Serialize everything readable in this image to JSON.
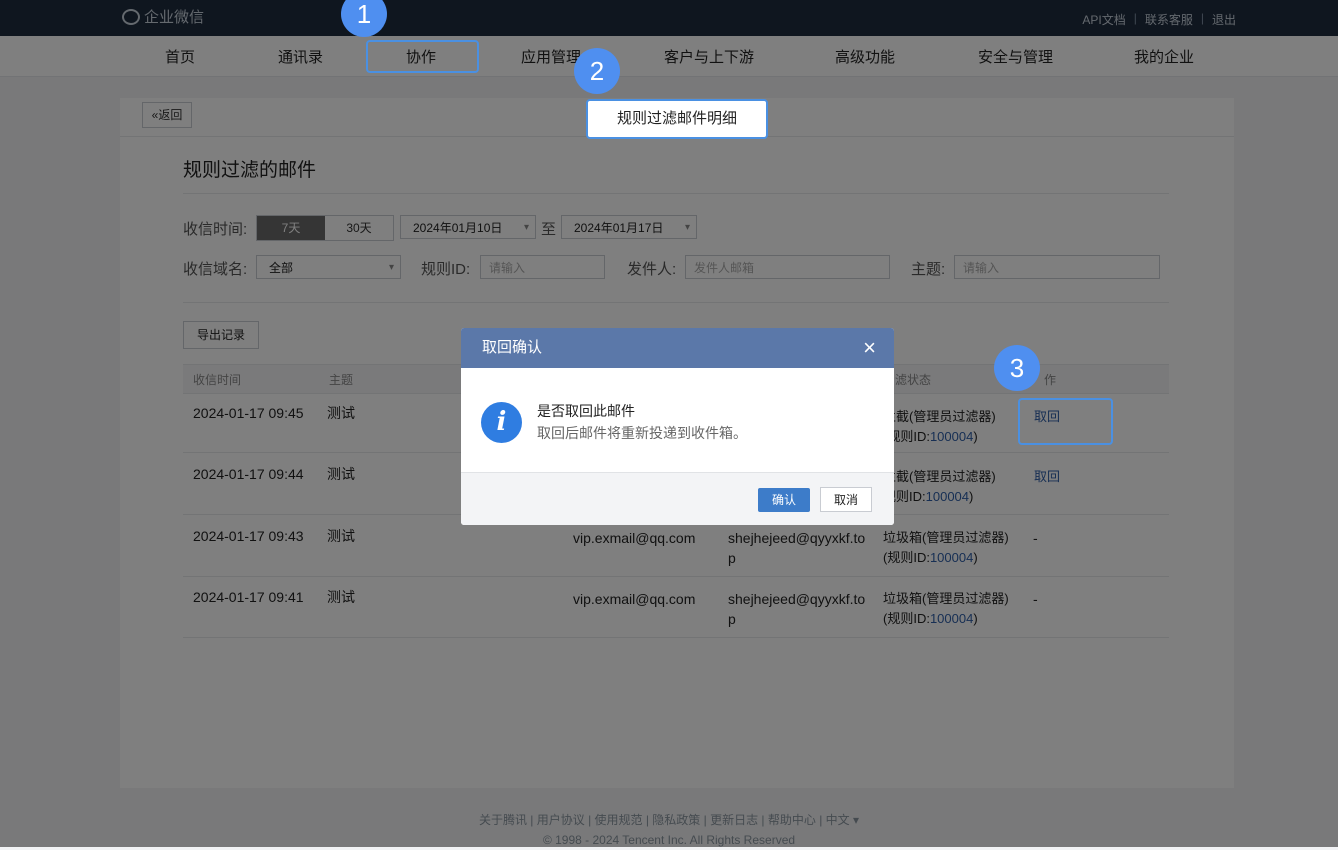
{
  "topbar": {
    "logo": "企业微信",
    "links": [
      "API文档",
      "联系客服",
      "退出"
    ]
  },
  "nav": {
    "items": [
      "首页",
      "通讯录",
      "协作",
      "应用管理",
      "客户与上下游",
      "高级功能",
      "安全与管理",
      "我的企业"
    ]
  },
  "page": {
    "back_label": "«返回",
    "header_title": "规则过滤邮件明细",
    "section_title": "规则过滤的邮件",
    "filters": {
      "time_label": "收信时间:",
      "time_options": [
        "7天",
        "30天"
      ],
      "date_from": "2024年01月10日",
      "date_sep": "至",
      "date_to": "2024年01月17日",
      "domain_label": "收信域名:",
      "domain_value": "全部",
      "rule_label": "规则ID:",
      "rule_placeholder": "请输入",
      "sender_label": "发件人:",
      "sender_placeholder": "发件人邮箱",
      "subject_label": "主题:",
      "subject_placeholder": "请输入"
    },
    "export_label": "导出记录",
    "table": {
      "headers": [
        "收信时间",
        "主题",
        "滤状态",
        "作"
      ],
      "rows": [
        {
          "time": "2024-01-17 09:45",
          "subject": "测试",
          "from": "",
          "to": "",
          "status1": "拦截(管理员过滤器)",
          "status2": "(规则ID:",
          "rule_id": "100004",
          "status_end": ")",
          "action": "取回"
        },
        {
          "time": "2024-01-17 09:44",
          "subject": "测试",
          "from": "",
          "to": "",
          "status1": "拦截(管理员过滤器)",
          "status2": "规则ID:",
          "rule_id": "100004",
          "status_end": ")",
          "action": "取回"
        },
        {
          "time": "2024-01-17 09:43",
          "subject": "测试",
          "from": "vip.exmail@qq.com",
          "to1": "shejhejeed@qyyxkf.to",
          "to2": "p",
          "status1": "垃圾箱(管理员过滤器)",
          "status2": "(规则ID:",
          "rule_id": "100004",
          "status_end": ")",
          "action": "-"
        },
        {
          "time": "2024-01-17 09:41",
          "subject": "测试",
          "from": "vip.exmail@qq.com",
          "to1": "shejhejeed@qyyxkf.to",
          "to2": "p",
          "status1": "垃圾箱(管理员过滤器)",
          "status2": "(规则ID:",
          "rule_id": "100004",
          "status_end": ")",
          "action": "-"
        }
      ]
    }
  },
  "dialog": {
    "title": "取回确认",
    "close": "×",
    "icon": "i",
    "message": "是否取回此邮件",
    "detail": "取回后邮件将重新投递到收件箱。",
    "ok_label": "确认",
    "cancel_label": "取消"
  },
  "footer": {
    "links": "关于腾讯 | 用户协议 | 使用规范 | 隐私政策 | 更新日志 | 帮助中心 | 中文 ▾",
    "copyright": "© 1998 - 2024 Tencent Inc. All Rights Reserved"
  },
  "markers": [
    "1",
    "2",
    "3"
  ],
  "colors": {
    "topbar": "#1f2c3f",
    "accent": "#4a90e2",
    "dialog_header": "#5b78a9",
    "link": "#2f5fa8"
  }
}
